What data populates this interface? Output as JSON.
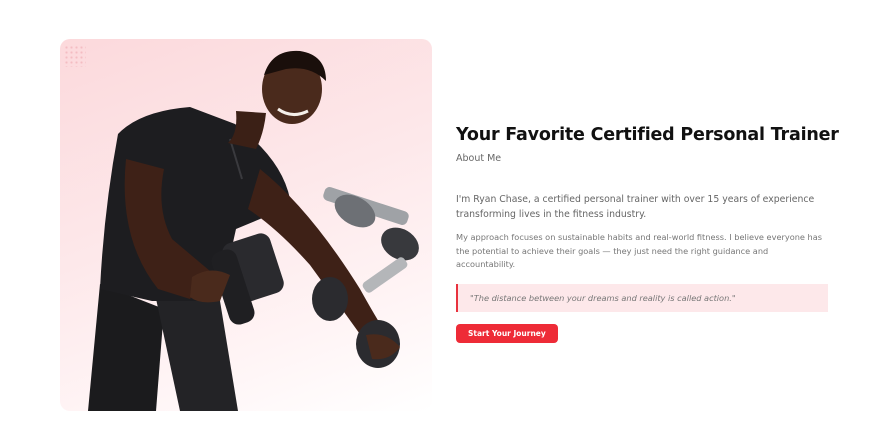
{
  "about": {
    "headline": "Your Favorite Certified Personal Trainer",
    "eyebrow": "About Me",
    "paragraph_1": "I'm Ryan Chase, a certified personal trainer with over 15 years of experience transforming lives in the fitness industry.",
    "paragraph_2": "My approach focuses on sustainable habits and real-world fitness. I believe everyone has the potential to achieve their goals — they just need the right guidance and accountability.",
    "quote": "\"The distance between your dreams and reality is called action.\"",
    "cta_label": "Start Your Journey"
  },
  "colors": {
    "accent": "#ee2b37",
    "quote_background": "#fde8ea",
    "card_background": "#fcd9dc"
  }
}
